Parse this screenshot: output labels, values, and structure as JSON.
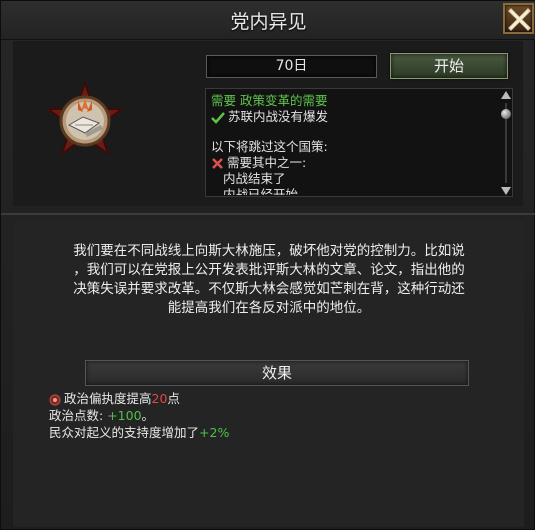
{
  "window": {
    "title": "党内异见"
  },
  "timer": {
    "days": "70日"
  },
  "actions": {
    "start_label": "开始"
  },
  "requirements": {
    "need_label": "需要 政策变革的需要",
    "condition_met": "苏联内战没有爆发",
    "bypass_header": "以下将跳过这个国策:",
    "need_one_of": "需要其中之一:",
    "option_1": "内战结束了",
    "option_2_partial": "内战已经开始"
  },
  "description": {
    "lines": [
      "我们要在不同战线上向斯大林施压，破坏他对党的控制力。比如说",
      "，我们可以在党报上公开发表批评斯大林的文章、论文，指出他的",
      "决策失误并要求改革。不仅斯大林会感觉如芒刺在背，这种行动还",
      "能提高我们在各反对派中的地位。"
    ]
  },
  "effects": {
    "header": "效果",
    "paranoia_prefix": "政治偏执度提高",
    "paranoia_value": "20",
    "paranoia_suffix": "点",
    "political_power_prefix": "政治点数: ",
    "political_power_value": "+100",
    "political_power_suffix": "。",
    "uprising_prefix": "民众对起义的支持度增加了",
    "uprising_value": "+2%"
  },
  "colors": {
    "met_green": "#5ec24a",
    "unmet_red": "#e05050",
    "accent_bronze": "#8a6a3a"
  },
  "icons": {
    "close": "close-x-icon",
    "focus": "focus-badge-icon",
    "check": "checkmark-icon",
    "cross": "cross-icon",
    "paranoia": "paranoia-eye-icon"
  }
}
